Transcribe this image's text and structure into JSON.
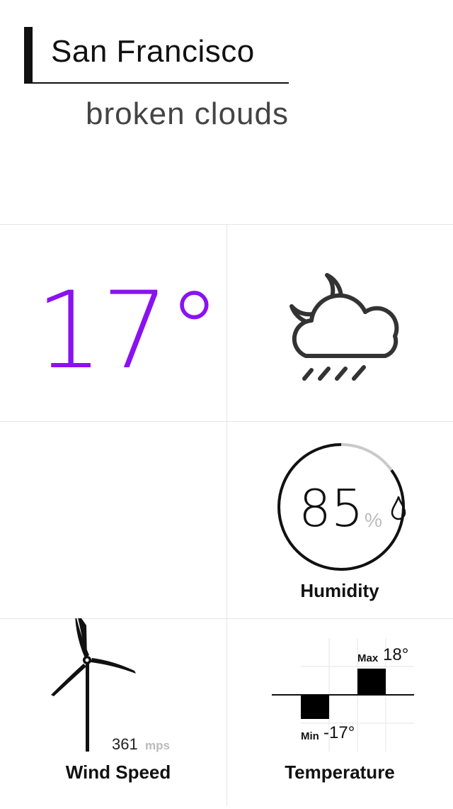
{
  "header": {
    "city": "San Francisco",
    "condition": "broken clouds"
  },
  "current": {
    "temperature": "17°",
    "temperature_color": "#8a12f0",
    "weather_icon": "cloud-moon-rain-icon"
  },
  "humidity": {
    "value": "85",
    "unit": "%",
    "label": "Humidity",
    "fraction": 0.85,
    "icon": "water-drop-icon"
  },
  "wind": {
    "value": "361",
    "unit": "mps",
    "label": "Wind Speed",
    "icon": "wind-turbine-icon"
  },
  "temperature_range": {
    "max_label": "Max",
    "max_value": "18°",
    "min_label": "Min",
    "min_value": "-17°",
    "label": "Temperature"
  }
}
